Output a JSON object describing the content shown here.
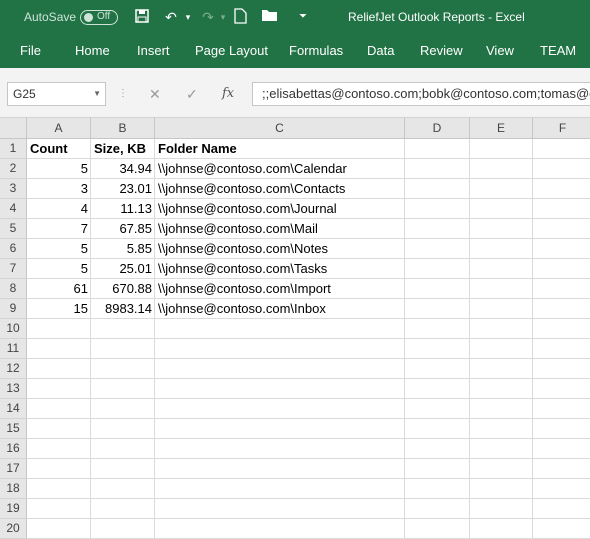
{
  "titlebar": {
    "autosave_label": "AutoSave",
    "autosave_state": "Off",
    "title": "ReliefJet Outlook Reports  -  Excel"
  },
  "ribbon": {
    "tabs": [
      "File",
      "Home",
      "Insert",
      "Page Layout",
      "Formulas",
      "Data",
      "Review",
      "View",
      "TEAM"
    ]
  },
  "formula_bar": {
    "name_box": "G25",
    "fx_label": "fx",
    "content": ";;elisabettas@contoso.com;bobk@contoso.com;tomas@contoso.com"
  },
  "sheet": {
    "columns": [
      "A",
      "B",
      "C",
      "D",
      "E",
      "F"
    ],
    "rows": [
      {
        "n": "1",
        "a": "Count",
        "b": "Size, KB",
        "c": "Folder Name"
      },
      {
        "n": "2",
        "a": "5",
        "b": "34.94",
        "c": "\\\\johnse@contoso.com\\Calendar"
      },
      {
        "n": "3",
        "a": "3",
        "b": "23.01",
        "c": "\\\\johnse@contoso.com\\Contacts"
      },
      {
        "n": "4",
        "a": "4",
        "b": "11.13",
        "c": "\\\\johnse@contoso.com\\Journal"
      },
      {
        "n": "5",
        "a": "7",
        "b": "67.85",
        "c": "\\\\johnse@contoso.com\\Mail"
      },
      {
        "n": "6",
        "a": "5",
        "b": "5.85",
        "c": "\\\\johnse@contoso.com\\Notes"
      },
      {
        "n": "7",
        "a": "5",
        "b": "25.01",
        "c": "\\\\johnse@contoso.com\\Tasks"
      },
      {
        "n": "8",
        "a": "61",
        "b": "670.88",
        "c": "\\\\johnse@contoso.com\\Import"
      },
      {
        "n": "9",
        "a": "15",
        "b": "8983.14",
        "c": "\\\\johnse@contoso.com\\Inbox"
      },
      {
        "n": "10",
        "a": "",
        "b": "",
        "c": ""
      },
      {
        "n": "11",
        "a": "",
        "b": "",
        "c": ""
      },
      {
        "n": "12",
        "a": "",
        "b": "",
        "c": ""
      },
      {
        "n": "13",
        "a": "",
        "b": "",
        "c": ""
      },
      {
        "n": "14",
        "a": "",
        "b": "",
        "c": ""
      },
      {
        "n": "15",
        "a": "",
        "b": "",
        "c": ""
      },
      {
        "n": "16",
        "a": "",
        "b": "",
        "c": ""
      },
      {
        "n": "17",
        "a": "",
        "b": "",
        "c": ""
      },
      {
        "n": "18",
        "a": "",
        "b": "",
        "c": ""
      },
      {
        "n": "19",
        "a": "",
        "b": "",
        "c": ""
      },
      {
        "n": "20",
        "a": "",
        "b": "",
        "c": ""
      }
    ]
  },
  "colors": {
    "excel_green": "#217346",
    "header_gray": "#e6e6e6",
    "gridline": "#dadada"
  }
}
